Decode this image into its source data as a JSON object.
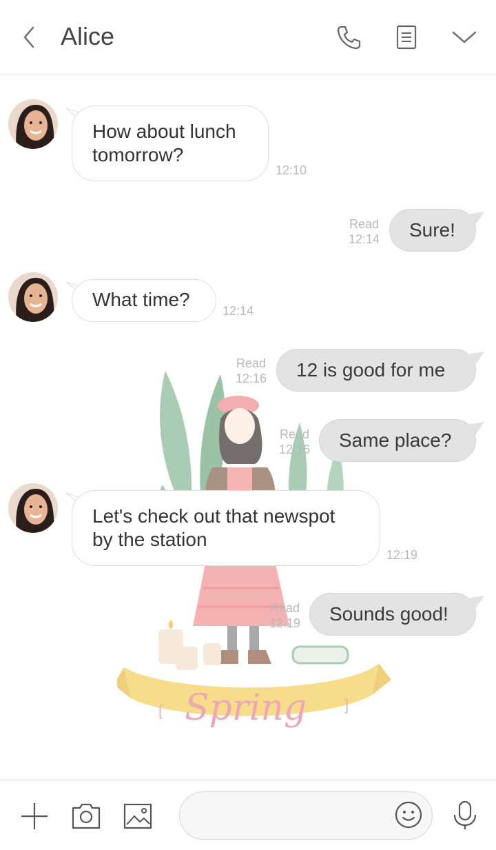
{
  "header": {
    "contact_name": "Alice",
    "icons": [
      "back-arrow-icon",
      "phone-icon",
      "notes-icon",
      "chevron-down-icon"
    ]
  },
  "messages": [
    {
      "side": "in",
      "text": "How about lunch tomorrow?",
      "time": "12:10"
    },
    {
      "side": "out",
      "text": "Sure!",
      "read": "Read",
      "time": "12:14"
    },
    {
      "side": "in",
      "text": "What time?",
      "time": "12:14"
    },
    {
      "side": "out",
      "text": "12 is good for me",
      "read": "Read",
      "time": "12:16"
    },
    {
      "side": "out",
      "text": "Same place?",
      "read": "Read",
      "time": "12:16"
    },
    {
      "side": "in",
      "text": "Let's check out that newspot by the station",
      "time": "12:19"
    },
    {
      "side": "out",
      "text": "Sounds good!",
      "read": "Read",
      "time": "12:19"
    }
  ],
  "background": {
    "theme_label": "Spring",
    "brackets_left": "[",
    "brackets_right": "]"
  },
  "input": {
    "message_value": "",
    "placeholder": "",
    "icons": [
      "plus-icon",
      "camera-icon",
      "image-icon",
      "emoji-icon",
      "microphone-icon"
    ]
  },
  "colors": {
    "outgoing_bubble": "#e3e3e3",
    "incoming_bubble": "#ffffff",
    "meta_text": "#b9b9b9"
  }
}
